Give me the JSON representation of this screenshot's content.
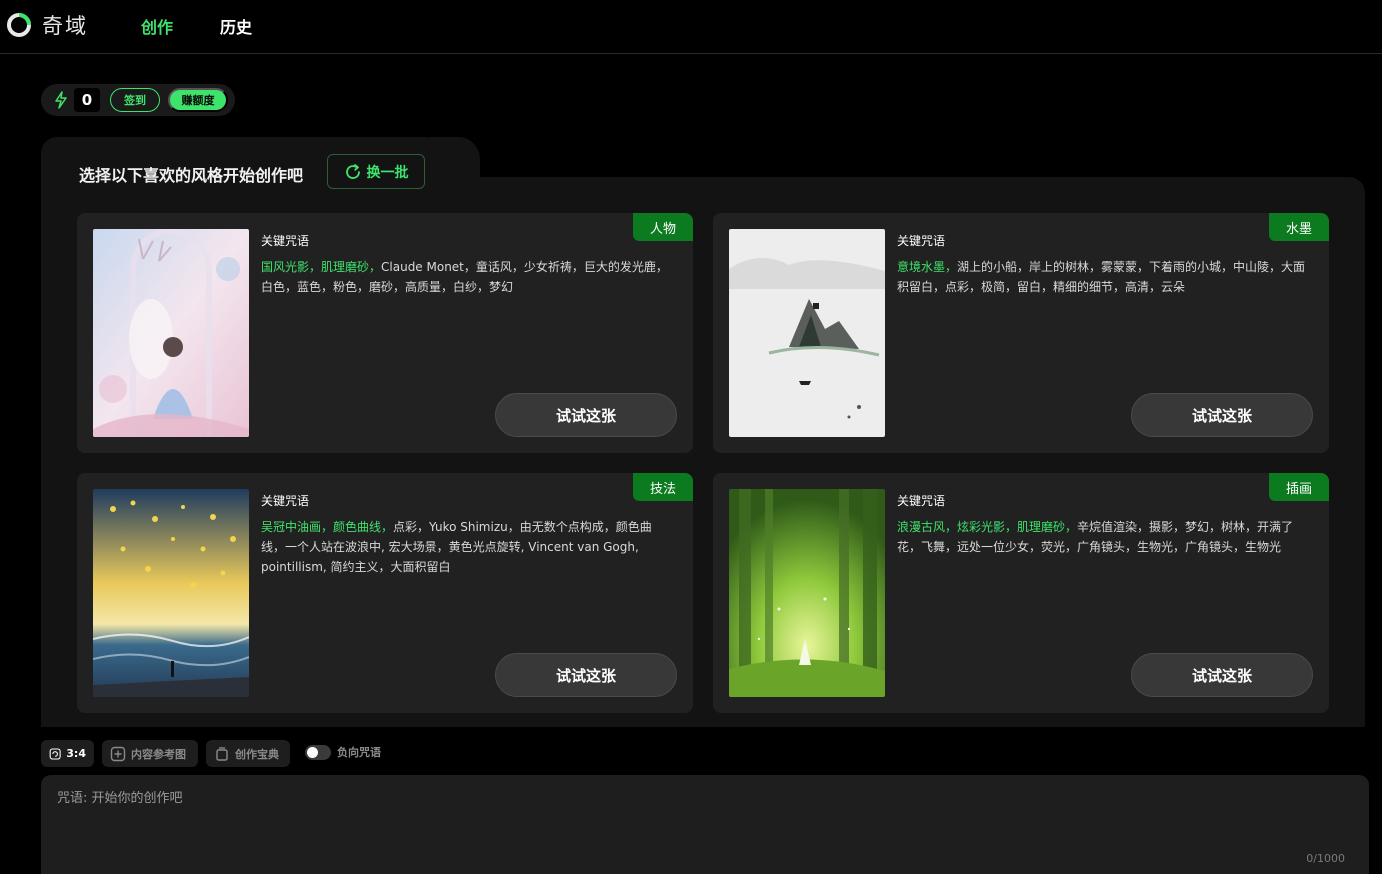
{
  "app": {
    "name": "奇域"
  },
  "nav": {
    "items": [
      {
        "label": "创作",
        "active": true
      },
      {
        "label": "历史",
        "active": false
      }
    ]
  },
  "credits": {
    "count": "0",
    "signin_label": "签到",
    "earn_label": "赚额度"
  },
  "panel": {
    "title": "选择以下喜欢的风格开始创作吧",
    "refresh_label": "换一批"
  },
  "cards": [
    {
      "tag": "人物",
      "keyword_label": "关键咒语",
      "highlight": "国风光影，肌理磨砂，",
      "text": "Claude Monet，童话风，少女祈祷，巨大的发光鹿，白色，蓝色，粉色，磨砂，高质量，白纱，梦幻",
      "button": "试试这张"
    },
    {
      "tag": "水墨",
      "keyword_label": "关键咒语",
      "highlight": "意境水墨，",
      "text": "湖上的小船，岸上的树林，雾蒙蒙，下着雨的小城，中山陵，大面积留白，点彩，极简，留白，精细的细节，高清，云朵",
      "button": "试试这张"
    },
    {
      "tag": "技法",
      "keyword_label": "关键咒语",
      "highlight": "吴冠中油画，颜色曲线，",
      "text": "点彩，Yuko Shimizu，由无数个点构成，颜色曲线，一个人站在波浪中, 宏大场景，黄色光点旋转, Vincent van Gogh, pointillism, 简约主义，大面积留白",
      "button": "试试这张"
    },
    {
      "tag": "插画",
      "keyword_label": "关键咒语",
      "highlight": "浪漫古风，炫彩光影，肌理磨砂，",
      "text": "辛烷值渲染，摄影，梦幻，树林，开满了花，飞舞，远处一位少女，荧光，广角镜头，生物光，广角镜头，生物光",
      "button": "试试这张"
    }
  ],
  "toolbar": {
    "ratio_label": "3:4",
    "reference_label": "内容参考图",
    "book_label": "创作宝典",
    "negative_label": "负向咒语"
  },
  "prompt": {
    "placeholder": "咒语: 开始你的创作吧",
    "counter": "0/1000"
  },
  "colors": {
    "accent": "#3ee36c",
    "tag_bg": "#0c7a1e",
    "panel_bg": "#131313",
    "card_bg": "#212121"
  }
}
